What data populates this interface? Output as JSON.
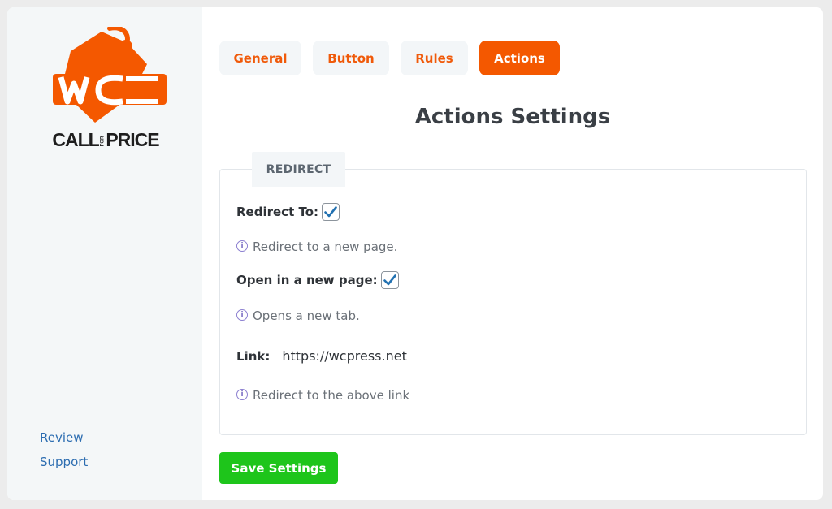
{
  "sidebar": {
    "logo": {
      "text_left": "CALL",
      "text_for": "FOR",
      "text_right": "PRICE",
      "accent_color": "#f45800"
    },
    "links": {
      "review": "Review",
      "support": "Support"
    }
  },
  "tabs": [
    {
      "label": "General",
      "active": false
    },
    {
      "label": "Button",
      "active": false
    },
    {
      "label": "Rules",
      "active": false
    },
    {
      "label": "Actions",
      "active": true
    }
  ],
  "page": {
    "title": "Actions Settings",
    "section_tab": "REDIRECT"
  },
  "fields": {
    "redirect_to": {
      "label": "Redirect To:",
      "checked": true,
      "help": "Redirect to a new page."
    },
    "open_new_page": {
      "label": "Open in a new page:",
      "checked": true,
      "help": "Opens a new tab."
    },
    "link": {
      "label": "Link:",
      "value": "https://wcpress.net",
      "help": "Redirect to the above link"
    }
  },
  "save_button": "Save Settings",
  "icons": {
    "info": "info-circle-icon",
    "check": "checkmark-icon"
  },
  "colors": {
    "accent": "#f45800",
    "save": "#1ec51b",
    "link": "#2b6cb0",
    "check": "#2271b1"
  }
}
